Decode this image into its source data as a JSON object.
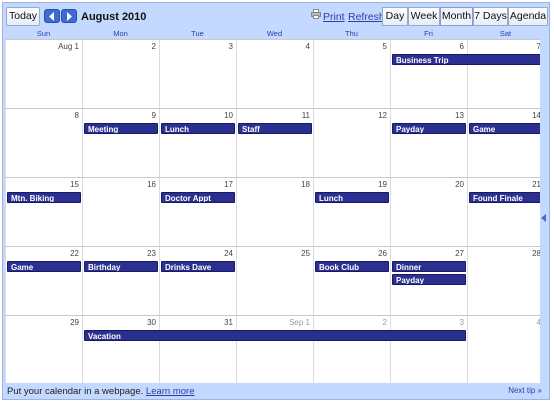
{
  "toolbar": {
    "today_label": "Today",
    "month_title": "August 2010",
    "print_label": "Print",
    "refresh_label": "Refresh",
    "views": [
      "Day",
      "Week",
      "Month",
      "7 Days",
      "Agenda"
    ],
    "active_view": "Month"
  },
  "days_of_week": [
    "Sun",
    "Mon",
    "Tue",
    "Wed",
    "Thu",
    "Fri",
    "Sat"
  ],
  "weeks": [
    {
      "days": [
        "Aug 1",
        "2",
        "3",
        "4",
        "5",
        "6",
        "7"
      ]
    },
    {
      "days": [
        "8",
        "9",
        "10",
        "11",
        "12",
        "13",
        "14"
      ]
    },
    {
      "days": [
        "15",
        "16",
        "17",
        "18",
        "19",
        "20",
        "21"
      ]
    },
    {
      "days": [
        "22",
        "23",
        "24",
        "25",
        "26",
        "27",
        "28"
      ]
    },
    {
      "days": [
        "29",
        "30",
        "31",
        "Sep 1",
        "2",
        "3",
        "4"
      ]
    }
  ],
  "events": [
    {
      "title": "Business Trip",
      "week": 0,
      "day": 5,
      "span": 2,
      "slot": 0
    },
    {
      "title": "Meeting",
      "week": 1,
      "day": 1,
      "span": 1,
      "slot": 0
    },
    {
      "title": "Lunch",
      "week": 1,
      "day": 2,
      "span": 1,
      "slot": 0
    },
    {
      "title": "Staff",
      "week": 1,
      "day": 3,
      "span": 1,
      "slot": 0
    },
    {
      "title": "Payday",
      "week": 1,
      "day": 5,
      "span": 1,
      "slot": 0
    },
    {
      "title": "Game",
      "week": 1,
      "day": 6,
      "span": 1,
      "slot": 0
    },
    {
      "title": "Mtn. Biking",
      "week": 2,
      "day": 0,
      "span": 1,
      "slot": 0
    },
    {
      "title": "Doctor Appt",
      "week": 2,
      "day": 2,
      "span": 1,
      "slot": 0
    },
    {
      "title": "Lunch",
      "week": 2,
      "day": 4,
      "span": 1,
      "slot": 0
    },
    {
      "title": "Found Finale",
      "week": 2,
      "day": 6,
      "span": 1,
      "slot": 0
    },
    {
      "title": "Game",
      "week": 3,
      "day": 0,
      "span": 1,
      "slot": 0
    },
    {
      "title": "Birthday",
      "week": 3,
      "day": 1,
      "span": 1,
      "slot": 0
    },
    {
      "title": "Drinks Dave",
      "week": 3,
      "day": 2,
      "span": 1,
      "slot": 0
    },
    {
      "title": "Book Club",
      "week": 3,
      "day": 4,
      "span": 1,
      "slot": 0
    },
    {
      "title": "Dinner",
      "week": 3,
      "day": 5,
      "span": 1,
      "slot": 0
    },
    {
      "title": "Payday",
      "week": 3,
      "day": 5,
      "span": 1,
      "slot": 1
    },
    {
      "title": "Vacation",
      "week": 4,
      "day": 1,
      "span": 5,
      "slot": 0
    }
  ],
  "footer": {
    "text": "Put your calendar in a webpage.",
    "link_label": "Learn more",
    "next_tip_label": "Next tip »"
  },
  "colors": {
    "chrome": "#c3d9ff",
    "event_bg": "#2b2f8f",
    "link": "#2a3fa8"
  }
}
